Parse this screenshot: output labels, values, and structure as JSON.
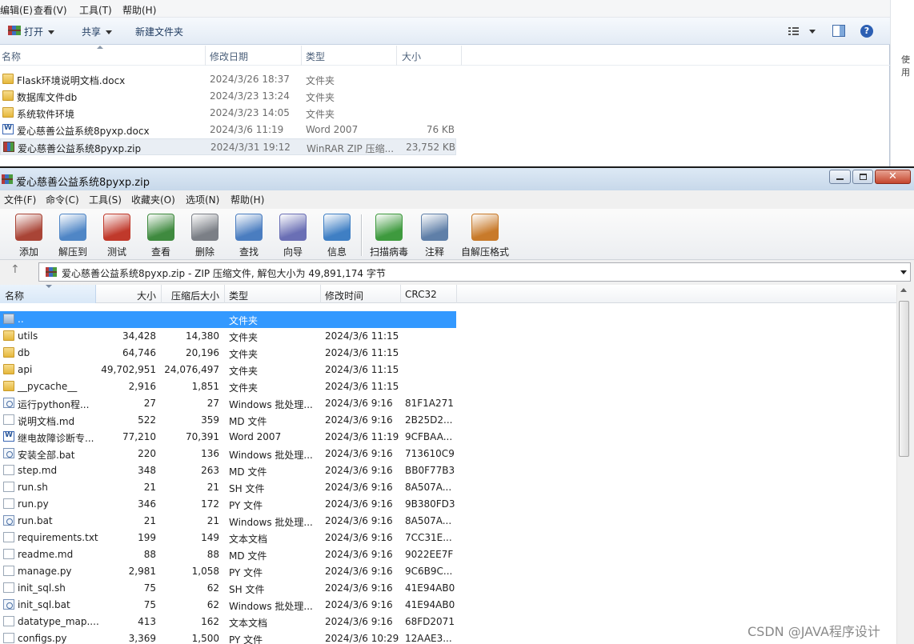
{
  "explorer": {
    "menu": [
      "编辑(E)",
      "查看(V)",
      "工具(T)",
      "帮助(H)"
    ],
    "toolbar": {
      "open_label": "打开",
      "share_label": "共享",
      "new_folder_label": "新建文件夹"
    },
    "columns": {
      "name": "名称",
      "date": "修改日期",
      "type": "类型",
      "size": "大小"
    },
    "rows": [
      {
        "icon": "folder-icon",
        "name": "Flask环境说明文档.docx",
        "date": "2024/3/26 18:37",
        "type": "文件夹",
        "size": ""
      },
      {
        "icon": "folder-icon",
        "name": "数据库文件db",
        "date": "2024/3/23 13:24",
        "type": "文件夹",
        "size": ""
      },
      {
        "icon": "folder-icon",
        "name": "系统软件环境",
        "date": "2024/3/23 14:05",
        "type": "文件夹",
        "size": ""
      },
      {
        "icon": "word-document-icon",
        "name": "爱心慈善公益系统8pyxp.docx",
        "date": "2024/3/6 11:19",
        "type": "Word 2007",
        "size": "76 KB"
      },
      {
        "icon": "winrar-archive-icon",
        "name": "爱心慈善公益系统8pyxp.zip",
        "date": "2024/3/31 19:12",
        "type": "WinRAR ZIP 压缩...",
        "size": "23,752 KB"
      }
    ],
    "selected_row": 4
  },
  "side_panel": {
    "label": "使用"
  },
  "winrar": {
    "title": "爱心慈善公益系统8pyxp.zip",
    "menu": [
      "文件(F)",
      "命令(C)",
      "工具(S)",
      "收藏夹(O)",
      "选项(N)",
      "帮助(H)"
    ],
    "tools": [
      {
        "label": "添加",
        "icon": "add-archive-icon"
      },
      {
        "label": "解压到",
        "icon": "extract-to-icon"
      },
      {
        "label": "测试",
        "icon": "test-icon"
      },
      {
        "label": "查看",
        "icon": "view-icon"
      },
      {
        "label": "删除",
        "icon": "delete-icon"
      },
      {
        "label": "查找",
        "icon": "find-icon"
      },
      {
        "label": "向导",
        "icon": "wizard-icon"
      },
      {
        "label": "信息",
        "icon": "info-icon"
      },
      {
        "label": "扫描病毒",
        "icon": "virus-scan-icon"
      },
      {
        "label": "注释",
        "icon": "comment-icon"
      },
      {
        "label": "自解压格式",
        "icon": "sfx-icon"
      }
    ],
    "path_text": "爱心慈善公益系统8pyxp.zip - ZIP 压缩文件, 解包大小为 49,891,174 字节",
    "columns": {
      "name": "名称",
      "size": "大小",
      "packed": "压缩后大小",
      "type": "类型",
      "modified": "修改时间",
      "crc": "CRC32"
    },
    "rows": [
      {
        "icon": "parent-folder-icon",
        "name": "..",
        "size": "",
        "packed": "",
        "type": "文件夹",
        "modified": "",
        "crc": ""
      },
      {
        "icon": "folder-icon",
        "name": "utils",
        "size": "34,428",
        "packed": "14,380",
        "type": "文件夹",
        "modified": "2024/3/6 11:15",
        "crc": ""
      },
      {
        "icon": "folder-icon",
        "name": "db",
        "size": "64,746",
        "packed": "20,196",
        "type": "文件夹",
        "modified": "2024/3/6 11:15",
        "crc": ""
      },
      {
        "icon": "folder-icon",
        "name": "api",
        "size": "49,702,951",
        "packed": "24,076,497",
        "type": "文件夹",
        "modified": "2024/3/6 11:15",
        "crc": ""
      },
      {
        "icon": "folder-icon",
        "name": "__pycache__",
        "size": "2,916",
        "packed": "1,851",
        "type": "文件夹",
        "modified": "2024/3/6 11:15",
        "crc": ""
      },
      {
        "icon": "batch-file-icon",
        "name": "运行python程...",
        "size": "27",
        "packed": "27",
        "type": "Windows 批处理...",
        "modified": "2024/3/6 9:16",
        "crc": "81F1A271"
      },
      {
        "icon": "text-file-icon",
        "name": "说明文档.md",
        "size": "522",
        "packed": "359",
        "type": "MD 文件",
        "modified": "2024/3/6 9:16",
        "crc": "2B25D2..."
      },
      {
        "icon": "word-document-icon",
        "name": "继电故障诊断专...",
        "size": "77,210",
        "packed": "70,391",
        "type": "Word 2007",
        "modified": "2024/3/6 11:19",
        "crc": "9CFBAA..."
      },
      {
        "icon": "batch-file-icon",
        "name": "安装全部.bat",
        "size": "220",
        "packed": "136",
        "type": "Windows 批处理...",
        "modified": "2024/3/6 9:16",
        "crc": "713610C9"
      },
      {
        "icon": "text-file-icon",
        "name": "step.md",
        "size": "348",
        "packed": "263",
        "type": "MD 文件",
        "modified": "2024/3/6 9:16",
        "crc": "BB0F77B3"
      },
      {
        "icon": "text-file-icon",
        "name": "run.sh",
        "size": "21",
        "packed": "21",
        "type": "SH 文件",
        "modified": "2024/3/6 9:16",
        "crc": "8A507A..."
      },
      {
        "icon": "text-file-icon",
        "name": "run.py",
        "size": "346",
        "packed": "172",
        "type": "PY 文件",
        "modified": "2024/3/6 9:16",
        "crc": "9B380FD3"
      },
      {
        "icon": "batch-file-icon",
        "name": "run.bat",
        "size": "21",
        "packed": "21",
        "type": "Windows 批处理...",
        "modified": "2024/3/6 9:16",
        "crc": "8A507A..."
      },
      {
        "icon": "text-file-icon",
        "name": "requirements.txt",
        "size": "199",
        "packed": "149",
        "type": "文本文档",
        "modified": "2024/3/6 9:16",
        "crc": "7CC31E..."
      },
      {
        "icon": "text-file-icon",
        "name": "readme.md",
        "size": "88",
        "packed": "88",
        "type": "MD 文件",
        "modified": "2024/3/6 9:16",
        "crc": "9022EE7F"
      },
      {
        "icon": "text-file-icon",
        "name": "manage.py",
        "size": "2,981",
        "packed": "1,058",
        "type": "PY 文件",
        "modified": "2024/3/6 9:16",
        "crc": "9C6B9C..."
      },
      {
        "icon": "text-file-icon",
        "name": "init_sql.sh",
        "size": "75",
        "packed": "62",
        "type": "SH 文件",
        "modified": "2024/3/6 9:16",
        "crc": "41E94AB0"
      },
      {
        "icon": "batch-file-icon",
        "name": "init_sql.bat",
        "size": "75",
        "packed": "62",
        "type": "Windows 批处理...",
        "modified": "2024/3/6 9:16",
        "crc": "41E94AB0"
      },
      {
        "icon": "text-file-icon",
        "name": "datatype_map....",
        "size": "413",
        "packed": "162",
        "type": "文本文档",
        "modified": "2024/3/6 9:16",
        "crc": "68FD2071"
      },
      {
        "icon": "text-file-icon",
        "name": "configs.py",
        "size": "3,369",
        "packed": "1,500",
        "type": "PY 文件",
        "modified": "2024/3/6 10:29",
        "crc": "12AAE3..."
      }
    ],
    "selected_row": 0
  },
  "watermark": "CSDN @JAVA程序设计",
  "colors": {
    "selection": "#3399ff",
    "explorer_selection": "#e9eef4",
    "close_button": "#c5452d"
  }
}
